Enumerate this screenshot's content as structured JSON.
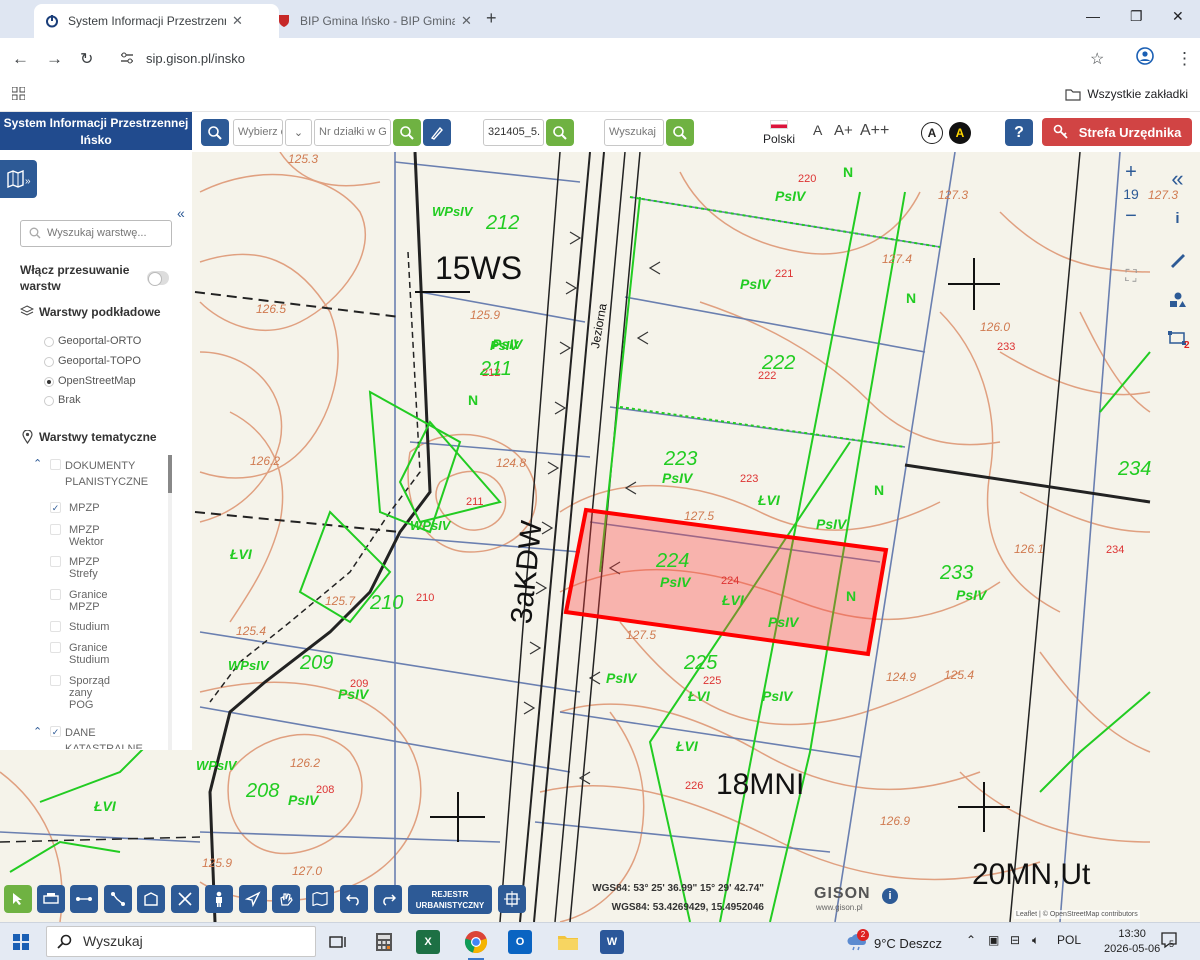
{
  "browser": {
    "tabs": [
      {
        "title": "System Informacji Przestrzenne",
        "active": true
      },
      {
        "title": "BIP Gmina Ińsko - BIP Gmina Iń",
        "active": false
      }
    ],
    "url": "sip.gison.pl/insko",
    "bookmarks_all": "Wszystkie zakładki"
  },
  "app": {
    "title": "System Informacji Przestrzennej Ińsko",
    "select_placeholder": "Wybierz c",
    "parcel_placeholder": "Nr działki w G",
    "parcel_id_value": "321405_5.",
    "search_placeholder": "Wyszukaj",
    "language": "Polski",
    "font_sizes": [
      "A",
      "A+",
      "A++"
    ],
    "contrast": [
      "A",
      "A"
    ],
    "help": "?",
    "officer_zone": "Strefa Urzędnika"
  },
  "panel": {
    "search_placeholder": "Wyszukaj warstwę...",
    "toggle_label": "Włącz przesuwanie warstw",
    "base_layers_title": "Warstwy podkładowe",
    "base_layers": [
      {
        "label": "Geoportal-ORTO",
        "selected": false
      },
      {
        "label": "Geoportal-TOPO",
        "selected": false
      },
      {
        "label": "OpenStreetMap",
        "selected": true
      },
      {
        "label": "Brak",
        "selected": false
      }
    ],
    "thematic_title": "Warstwy tematyczne",
    "groups": [
      {
        "label": "DOKUMENTY PLANISTYCZNE",
        "expanded": true
      },
      {
        "label": "DANE KATASTRALNE",
        "expanded": true
      }
    ],
    "items": [
      {
        "label": "MPZP",
        "checked": true
      },
      {
        "label": "MPZP Wektor",
        "checked": false
      },
      {
        "label": "MPZP Strefy",
        "checked": false
      },
      {
        "label": "Granice MPZP",
        "checked": false
      },
      {
        "label": "Studium",
        "checked": false
      },
      {
        "label": "Granice Studium",
        "checked": false
      },
      {
        "label": "Sporząd zany POG",
        "checked": false
      }
    ]
  },
  "map": {
    "zoom_level": "19",
    "zoom_in": "+",
    "zoom_out": "−",
    "layers_badge": "2",
    "labels_big": [
      "15WS",
      "3aKDW",
      "18MNI",
      "20MN,Ut"
    ],
    "parcels": [
      "212",
      "211",
      "210",
      "209",
      "208",
      "220",
      "221",
      "222",
      "223",
      "224",
      "225",
      "226",
      "233",
      "234"
    ],
    "landuse": [
      "PsIV",
      "ŁVI",
      "N",
      "WPsIV",
      "PsIV",
      "ŁVI"
    ],
    "heights": [
      "125.3",
      "126.5",
      "125.9",
      "126.2",
      "124.8",
      "125.7",
      "125.4",
      "127.3",
      "127.4",
      "126.0",
      "126.1",
      "125.4",
      "124.9",
      "127.3",
      "127.5",
      "126.9",
      "127.0",
      "125.9",
      "127.5",
      "126.2"
    ],
    "highlighted_parcel": "224",
    "street_name": "Jeziorna"
  },
  "bottom": {
    "register_label": "REJESTR URBANISTYCZNY",
    "coords_dms": "WGS84: 53° 25' 36.99\" 15° 29' 42.74\"",
    "coords_dec": "WGS84: 53.4269429, 15.4952046",
    "brand": "GISON",
    "brand_url": "www.gison.pl",
    "attribution": "Leaflet | © OpenStreetMap contributors"
  },
  "taskbar": {
    "search": "Wyszukaj",
    "weather": "9°C  Deszcz",
    "weather_badge": "2",
    "language": "POL",
    "time": "13:30",
    "date": "2026-05-06",
    "notifications": "5"
  },
  "colors": {
    "primary": "#2d5a96",
    "title_bg": "#214b8e",
    "green_btn": "#6fb242",
    "officer_btn": "#d14444",
    "contour": "#e0a080",
    "parcel_green": "#22cc22",
    "highlight": "#ff0000"
  }
}
